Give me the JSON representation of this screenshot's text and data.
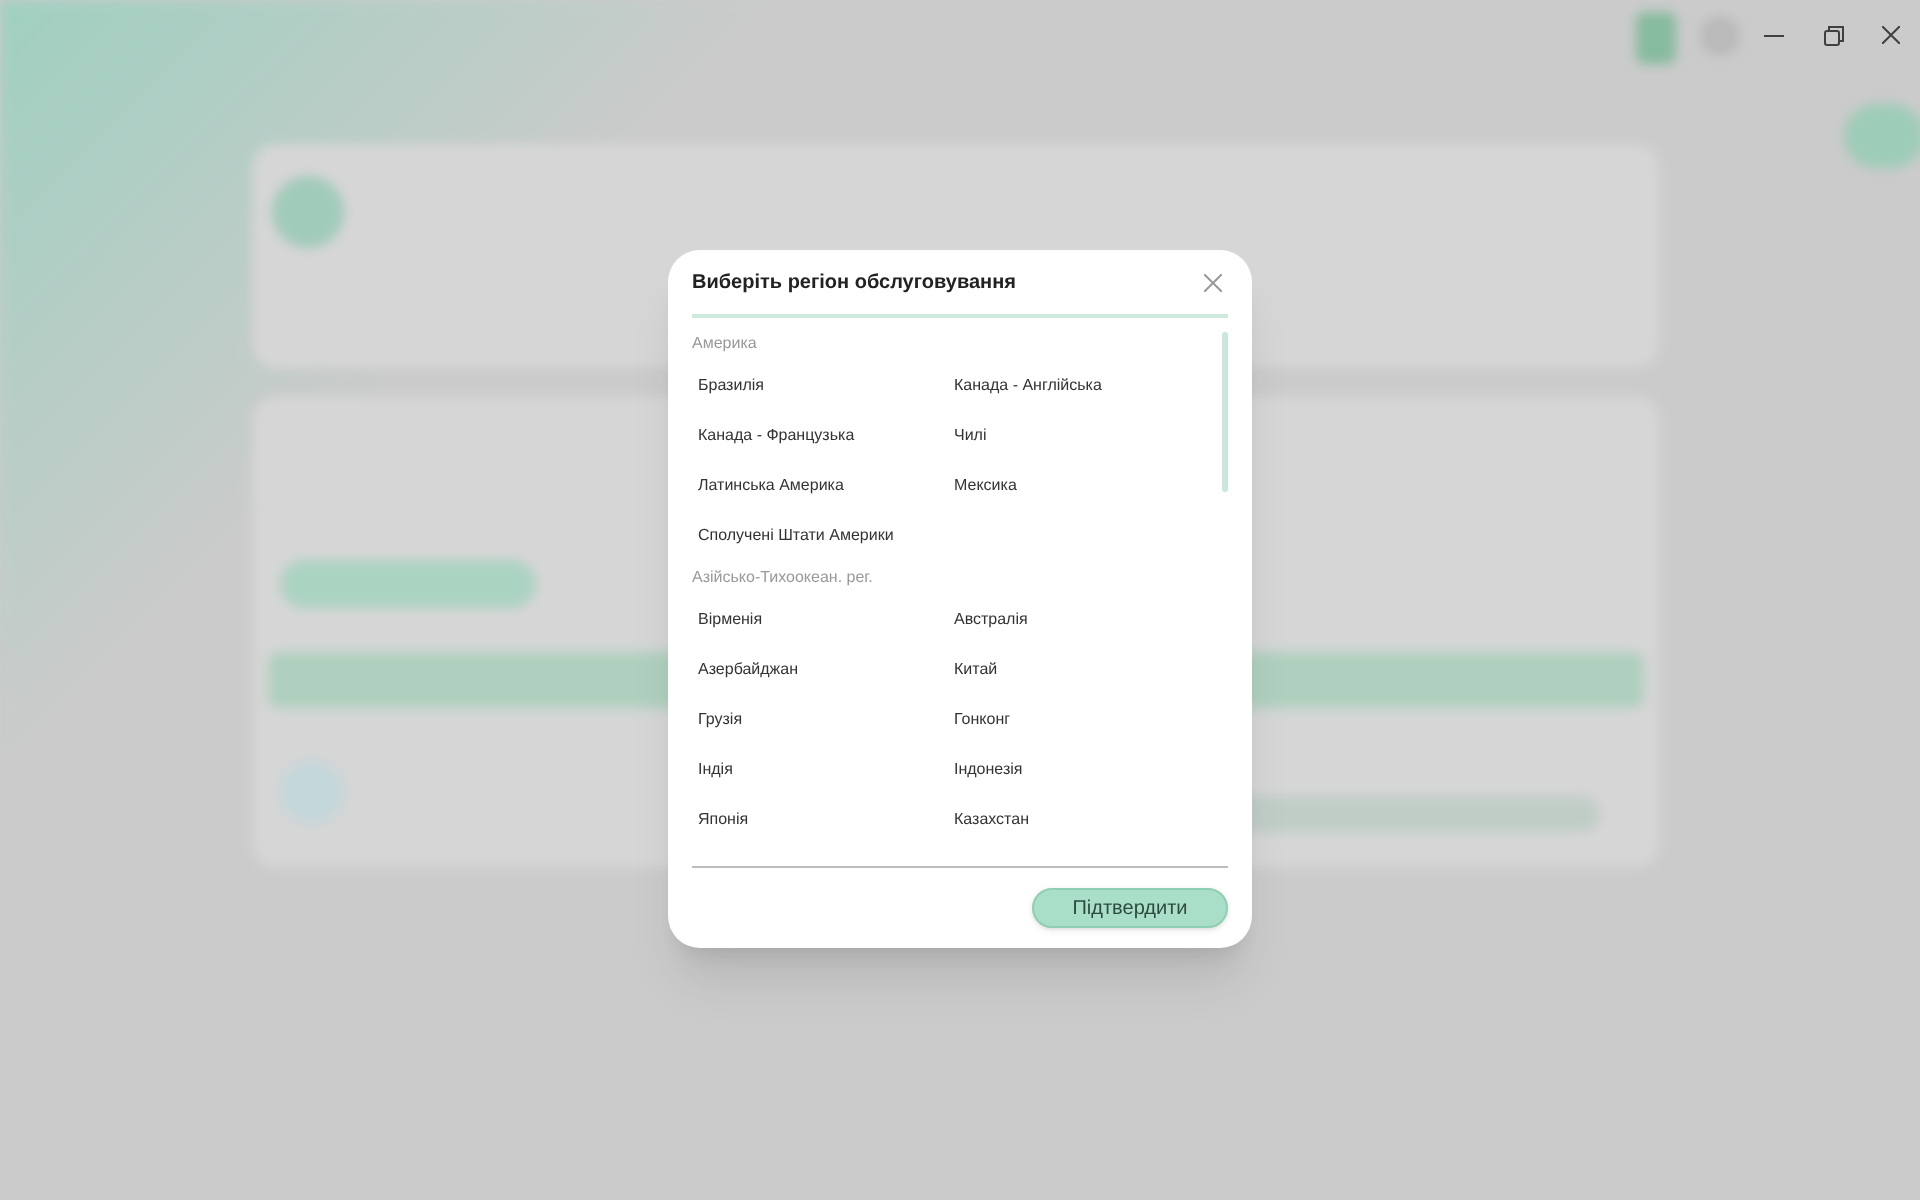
{
  "dialog": {
    "title": "Виберіть регіон обслуговування",
    "sections": [
      {
        "label": "Америка",
        "items": [
          "Бразилія",
          "Канада - Англійська",
          "Канада - Французька",
          "Чилі",
          "Латинська Америка",
          "Мексика",
          "Сполучені Штати Америки"
        ]
      },
      {
        "label": "Азійсько-Тихоокеан. рег.",
        "items": [
          "Вірменія",
          "Австралія",
          "Азербайджан",
          "Китай",
          "Грузія",
          "Гонконг",
          "Індія",
          "Індонезія",
          "Японія",
          "Казахстан"
        ]
      }
    ],
    "confirm_button": "Підтвердити"
  }
}
